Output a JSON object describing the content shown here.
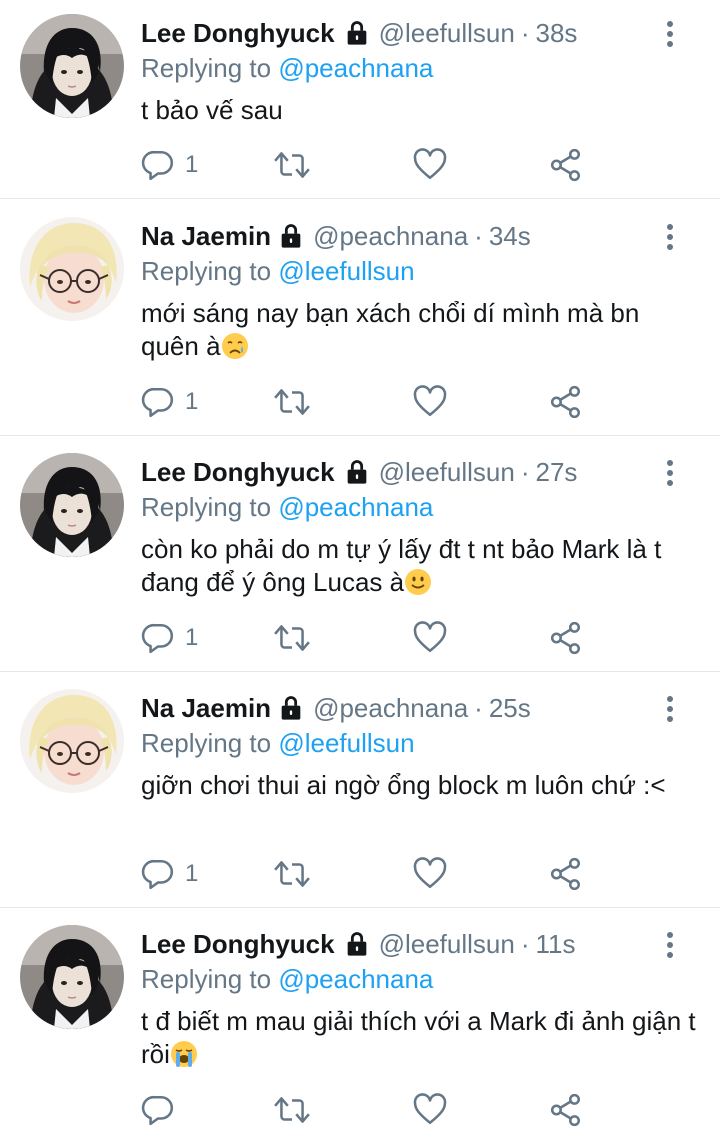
{
  "colors": {
    "accent": "#1da1f2",
    "secondary_text": "#657786",
    "divider": "#e1e8ed"
  },
  "tweets": [
    {
      "name": "Lee Donghyuck",
      "handle": "@leefullsun",
      "separator": "·",
      "time": "38s",
      "reply_prefix": "Replying to",
      "reply_to": "@peachnana",
      "text": "t bảo vế sau",
      "emoji": "",
      "reply_count": "1",
      "avatar": "avatar-dark-hair"
    },
    {
      "name": "Na Jaemin",
      "handle": "@peachnana",
      "separator": "·",
      "time": "34s",
      "reply_prefix": "Replying to",
      "reply_to": "@leefullsun",
      "text": "mới sáng nay bạn xách chổi dí mình mà bn quên à",
      "emoji": "crying-face-emoji",
      "reply_count": "1",
      "avatar": "avatar-blond-glasses"
    },
    {
      "name": "Lee Donghyuck",
      "handle": "@leefullsun",
      "separator": "·",
      "time": "27s",
      "reply_prefix": "Replying to",
      "reply_to": "@peachnana",
      "text": "còn ko phải do m tự ý lấy đt t nt bảo Mark là t đang để ý ông Lucas à",
      "emoji": "slightly-smiling-face-emoji",
      "reply_count": "1",
      "avatar": "avatar-dark-hair"
    },
    {
      "name": "Na Jaemin",
      "handle": "@peachnana",
      "separator": "·",
      "time": "25s",
      "reply_prefix": "Replying to",
      "reply_to": "@leefullsun",
      "text": "giỡn chơi thui ai ngờ ổng block m luôn chứ :<",
      "emoji": "",
      "reply_count": "1",
      "avatar": "avatar-blond-glasses"
    },
    {
      "name": "Lee Donghyuck",
      "handle": "@leefullsun",
      "separator": "·",
      "time": "11s",
      "reply_prefix": "Replying to",
      "reply_to": "@peachnana",
      "text": "t đ biết m mau giải thích với a Mark đi ảnh giận t rồi",
      "emoji": "loudly-crying-face-emoji",
      "reply_count": "",
      "avatar": "avatar-dark-hair"
    }
  ]
}
